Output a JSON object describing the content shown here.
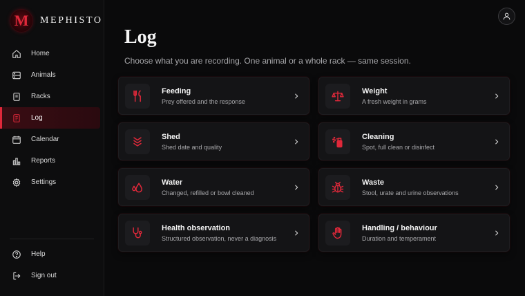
{
  "brand": {
    "logo_letter": "M",
    "name": "MEPHISTO"
  },
  "nav": {
    "items": [
      {
        "label": "Home",
        "icon": "home-icon"
      },
      {
        "label": "Animals",
        "icon": "animals-icon"
      },
      {
        "label": "Racks",
        "icon": "racks-icon"
      },
      {
        "label": "Log",
        "icon": "log-icon",
        "active": true
      },
      {
        "label": "Calendar",
        "icon": "calendar-icon"
      },
      {
        "label": "Reports",
        "icon": "reports-icon"
      },
      {
        "label": "Settings",
        "icon": "settings-icon"
      }
    ],
    "bottom": [
      {
        "label": "Help",
        "icon": "help-icon"
      },
      {
        "label": "Sign out",
        "icon": "sign-out-icon"
      }
    ]
  },
  "page": {
    "title": "Log",
    "subtitle": "Choose what you are recording. One animal or a whole rack — same session."
  },
  "cards": [
    {
      "title": "Feeding",
      "desc": "Prey offered and the response",
      "icon": "fork-knife-icon"
    },
    {
      "title": "Weight",
      "desc": "A fresh weight in grams",
      "icon": "scale-icon"
    },
    {
      "title": "Shed",
      "desc": "Shed date and quality",
      "icon": "shed-chevrons-icon"
    },
    {
      "title": "Cleaning",
      "desc": "Spot, full clean or disinfect",
      "icon": "spray-bottle-icon"
    },
    {
      "title": "Water",
      "desc": "Changed, refilled or bowl cleaned",
      "icon": "water-drops-icon"
    },
    {
      "title": "Waste",
      "desc": "Stool, urate and urine observations",
      "icon": "bug-icon"
    },
    {
      "title": "Health observation",
      "desc": "Structured observation, never a diagnosis",
      "icon": "stethoscope-icon"
    },
    {
      "title": "Handling / behaviour",
      "desc": "Duration and temperament",
      "icon": "hand-icon"
    }
  ],
  "colors": {
    "accent": "#e0283a",
    "background": "#0a0a0b",
    "card": "#141416"
  }
}
